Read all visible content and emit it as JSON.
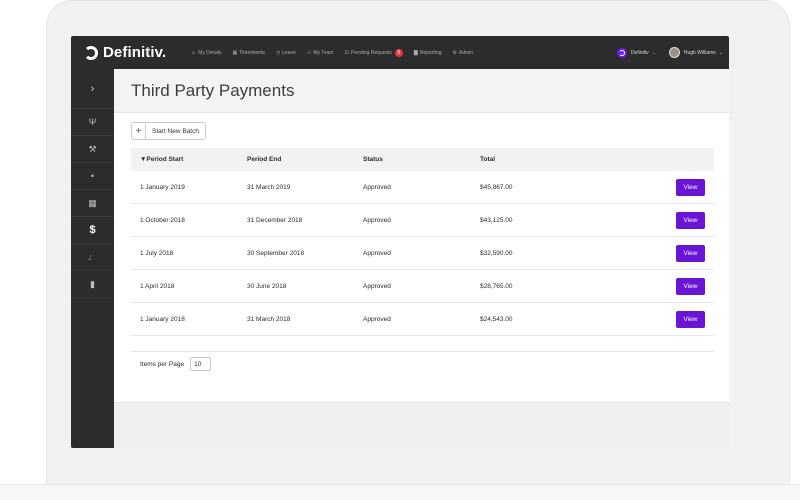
{
  "app": {
    "brand": "Definitiv."
  },
  "nav": [
    {
      "icon": "user-icon",
      "glyph": "☺",
      "label": "My Details"
    },
    {
      "icon": "timesheet-icon",
      "glyph": "▦",
      "label": "Timesheets"
    },
    {
      "icon": "leave-icon",
      "glyph": "◷",
      "label": "Leave"
    },
    {
      "icon": "team-icon",
      "glyph": "⚇",
      "label": "My Team"
    },
    {
      "icon": "check-icon",
      "glyph": "☑",
      "label": "Pending Requests",
      "badge": "5"
    },
    {
      "icon": "chart-icon",
      "glyph": "▇",
      "label": "Reporting"
    },
    {
      "icon": "gear-icon",
      "glyph": "⚙",
      "label": "Admin"
    }
  ],
  "topbar": {
    "org_name": "Definitiv",
    "user_name": "Hugh Williams"
  },
  "sidebar": [
    {
      "name": "expand-arrow-icon",
      "glyph": "›"
    },
    {
      "name": "fork-icon",
      "glyph": "Ψ"
    },
    {
      "name": "tools-icon",
      "glyph": "⚒"
    },
    {
      "name": "lightbulb-icon",
      "glyph": "•"
    },
    {
      "name": "calendar-icon",
      "glyph": "▦"
    },
    {
      "name": "dollar-icon",
      "glyph": "$"
    },
    {
      "name": "microphone-icon",
      "glyph": "♩"
    },
    {
      "name": "document-icon",
      "glyph": "▮"
    }
  ],
  "page": {
    "title": "Third Party Payments",
    "new_batch_label": "Start New Batch",
    "plus": "+"
  },
  "table": {
    "headers": [
      "▼Period Start",
      "Period End",
      "Status",
      "Total"
    ],
    "rows": [
      {
        "start": "1 January 2019",
        "end": "31 March 2019",
        "status": "Approved",
        "total": "$45,867.00",
        "action": "View"
      },
      {
        "start": "1 October 2018",
        "end": "31 December 2018",
        "status": "Approved",
        "total": "$43,125.00",
        "action": "View"
      },
      {
        "start": "1 July 2018",
        "end": "30 September 2018",
        "status": "Approved",
        "total": "$32,590.00",
        "action": "View"
      },
      {
        "start": "1 April 2018",
        "end": "30 June 2018",
        "status": "Approved",
        "total": "$28,765.00",
        "action": "View"
      },
      {
        "start": "1 January 2018",
        "end": "31 March 2018",
        "status": "Approved",
        "total": "$24,543.00",
        "action": "View"
      }
    ]
  },
  "pagination": {
    "items_per_page_label": "Items per Page",
    "items_per_page_value": "10"
  },
  "colors": {
    "accent": "#6a14d6",
    "topbar": "#2b2c2e",
    "badge": "#e4393c"
  }
}
